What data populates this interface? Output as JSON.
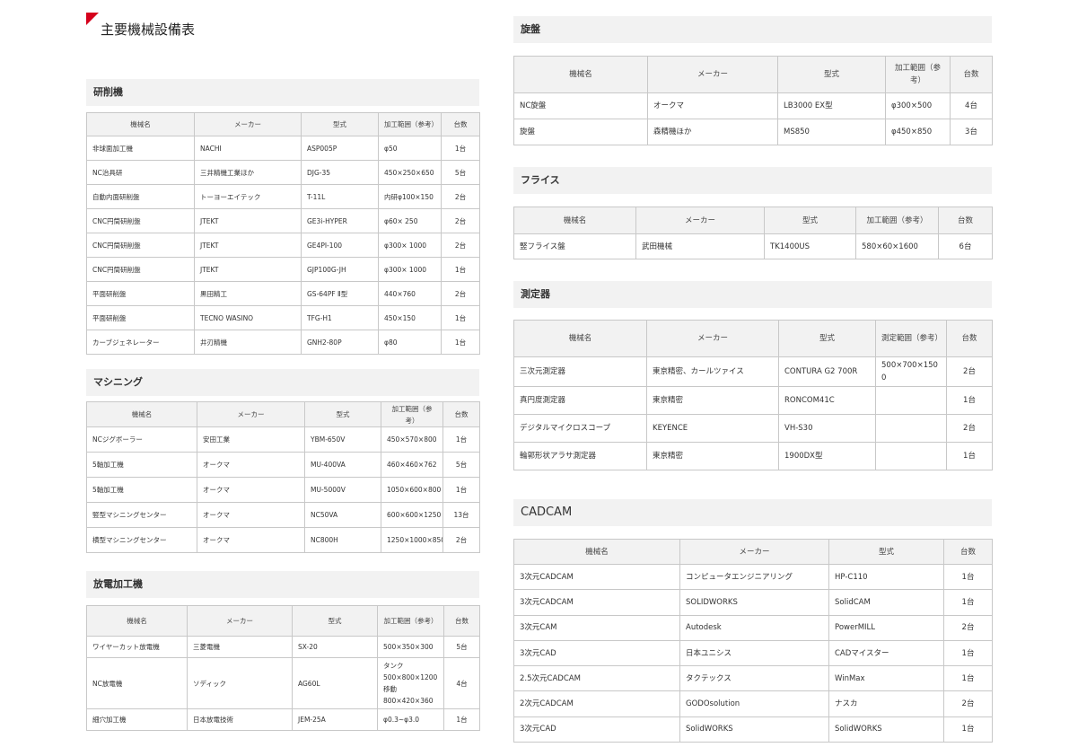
{
  "page": {
    "title": "主要機械設備表"
  },
  "columns": {
    "name": "機械名",
    "maker": "メーカー",
    "model": "型式",
    "range": "加工範囲（参考）",
    "measure": "測定範囲（参考）",
    "count": "台数"
  },
  "kensaku": {
    "title": "研削機",
    "rows": [
      [
        "非球面加工機",
        "NACHI",
        "ASP005P",
        "φ50",
        "1台"
      ],
      [
        "NC治具研",
        "三井精機工業ほか",
        "DJG-35",
        "450×250×650",
        "5台"
      ],
      [
        "自動内面研削盤",
        "トーヨーエイテック",
        "T-11L",
        "内研φ100×150",
        "2台"
      ],
      [
        "CNC円筒研削盤",
        "JTEKT",
        "GE3i-HYPER",
        "φ60× 250",
        "2台"
      ],
      [
        "CNC円筒研削盤",
        "JTEKT",
        "GE4PI-100",
        "φ300× 1000",
        "2台"
      ],
      [
        "CNC円筒研削盤",
        "JTEKT",
        "GJP100G-JH",
        "φ300× 1000",
        "1台"
      ],
      [
        "平面研削盤",
        "黒田精工",
        "GS-64PF Ⅱ型",
        "440×760",
        "2台"
      ],
      [
        "平面研削盤",
        "TECNO WASINO",
        "TFG-H1",
        "450×150",
        "1台"
      ],
      [
        "カーブジェネレーター",
        "井刃精機",
        "GNH2-80P",
        "φ80",
        "1台"
      ]
    ]
  },
  "machining": {
    "title": "マシニング",
    "rows": [
      [
        "NCジグボーラー",
        "安田工業",
        "YBM-650V",
        "450×570×800",
        "1台"
      ],
      [
        "5軸加工機",
        "オークマ",
        "MU-400VA",
        "460×460×762",
        "5台"
      ],
      [
        "5軸加工機",
        "オークマ",
        "MU-5000V",
        "1050×600×800",
        "1台"
      ],
      [
        "竪型マシニングセンター",
        "オークマ",
        "NC50VA",
        "600×600×1250",
        "13台"
      ],
      [
        "横型マシニングセンター",
        "オークマ",
        "NC800H",
        "1250×1000×850",
        "2台"
      ]
    ]
  },
  "edm": {
    "title": "放電加工機",
    "rows": [
      [
        "ワイヤーカット放電機",
        "三菱電機",
        "SX-20",
        "500×350×300",
        "5台"
      ],
      [
        "NC放電機",
        "ソディック",
        "AG60L",
        "タンク\n500×800×1200\n移動\n800×420×360",
        "4台"
      ],
      [
        "細穴加工機",
        "日本放電技術",
        "JEM-25A",
        "φ0.3~φ3.0",
        "1台"
      ]
    ]
  },
  "lathe": {
    "title": "旋盤",
    "rows": [
      [
        "NC旋盤",
        "オークマ",
        "LB3000 EX型",
        "φ300×500",
        "4台"
      ],
      [
        "旋盤",
        "森精機ほか",
        "MS850",
        "φ450×850",
        "3台"
      ]
    ]
  },
  "milling": {
    "title": "フライス",
    "rows": [
      [
        "竪フライス盤",
        "武田機械",
        "TK1400US",
        "580×60×1600",
        "6台"
      ]
    ]
  },
  "measure": {
    "title": "測定器",
    "rows": [
      [
        "三次元測定器",
        "東京精密、カールツァイス",
        "CONTURA G2 700R",
        "500×700×150\n0",
        "2台"
      ],
      [
        "真円度測定器",
        "東京精密",
        "RONCOM41C",
        "",
        "1台"
      ],
      [
        "デジタルマイクロスコープ",
        "KEYENCE",
        "VH-S30",
        "",
        "2台"
      ],
      [
        "輪郭形状アラサ測定器",
        "東京精密",
        "1900DX型",
        "",
        "1台"
      ]
    ]
  },
  "cadcam": {
    "title": "CADCAM",
    "rows": [
      [
        "3次元CADCAM",
        "コンピュータエンジニアリング",
        "HP-C110",
        "1台"
      ],
      [
        "3次元CADCAM",
        "SOLIDWORKS",
        "SolidCAM",
        "1台"
      ],
      [
        "3次元CAM",
        "Autodesk",
        "PowerMILL",
        "2台"
      ],
      [
        "3次元CAD",
        "日本ユニシス",
        "CADマイスター",
        "1台"
      ],
      [
        "2.5次元CADCAM",
        "タクテックス",
        "WinMax",
        "1台"
      ],
      [
        "2次元CADCAM",
        "GODOsolution",
        "ナスカ",
        "2台"
      ],
      [
        "3次元CAD",
        "SolidWORKS",
        "SolidWORKS",
        "1台"
      ]
    ]
  }
}
